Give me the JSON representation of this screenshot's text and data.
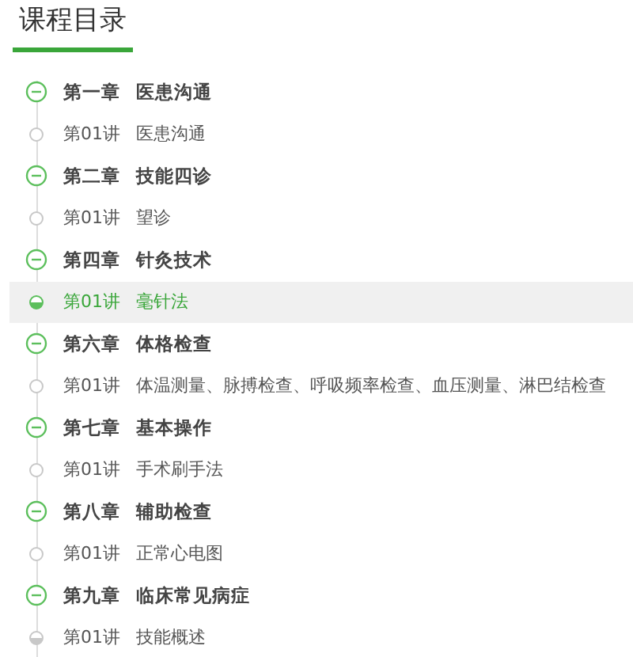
{
  "title": "课程目录",
  "chapters": [
    {
      "number": "第一章",
      "name": "医患沟通",
      "expanded": true,
      "children": [
        {
          "number": "第01讲",
          "name": "医患沟通",
          "selected": false,
          "started": false
        }
      ]
    },
    {
      "number": "第二章",
      "name": "技能四诊",
      "expanded": true,
      "children": [
        {
          "number": "第01讲",
          "name": "望诊",
          "selected": false,
          "started": false
        }
      ]
    },
    {
      "number": "第四章",
      "name": "针灸技术",
      "expanded": true,
      "children": [
        {
          "number": "第01讲",
          "name": "毫针法",
          "selected": true,
          "started": true
        }
      ]
    },
    {
      "number": "第六章",
      "name": "体格检查",
      "expanded": true,
      "children": [
        {
          "number": "第01讲",
          "name": "体温测量、脉搏检查、呼吸频率检查、血压测量、淋巴结检查",
          "selected": false,
          "started": false
        }
      ]
    },
    {
      "number": "第七章",
      "name": "基本操作",
      "expanded": true,
      "children": [
        {
          "number": "第01讲",
          "name": "手术刷手法",
          "selected": false,
          "started": false
        }
      ]
    },
    {
      "number": "第八章",
      "name": "辅助检查",
      "expanded": true,
      "children": [
        {
          "number": "第01讲",
          "name": "正常心电图",
          "selected": false,
          "started": false
        }
      ]
    },
    {
      "number": "第九章",
      "name": "临床常见病症",
      "expanded": true,
      "children": [
        {
          "number": "第01讲",
          "name": "技能概述",
          "selected": false,
          "started": true
        }
      ]
    }
  ]
}
